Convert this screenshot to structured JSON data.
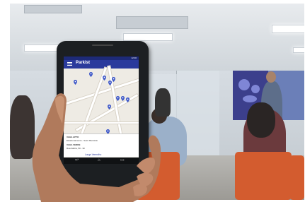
{
  "scene": {
    "description_colors": {
      "app_bar": "#2a3a9c",
      "pin": "#3e58c8",
      "chairs": "#d35c2f",
      "banner": "#3c3f8c"
    }
  },
  "phone_app": {
    "title": "Parkist",
    "status_text": "12:00",
    "info": {
      "line1": "VAGA APTO",
      "line2": "Estacionamento - Setor Bancário",
      "line3": "VAGA VERDE",
      "line4": "Rua Itabira, 50 - 30",
      "link": "Longe Vermelho"
    }
  }
}
